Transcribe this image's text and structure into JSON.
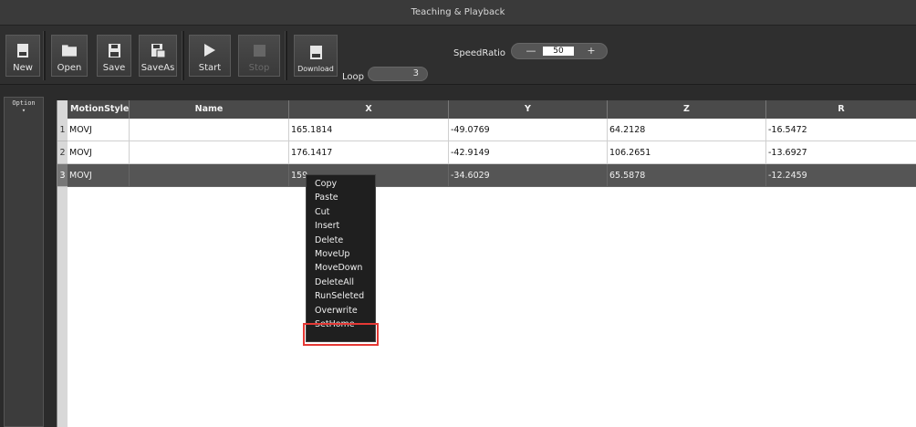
{
  "window": {
    "title": "Teaching & Playback"
  },
  "toolbar": {
    "new_label": "New",
    "open_label": "Open",
    "save_label": "Save",
    "saveas_label": "SaveAs",
    "start_label": "Start",
    "stop_label": "Stop",
    "download_label": "Download",
    "loop_label": "Loop",
    "loop_value": "3",
    "speed_label": "SpeedRatio",
    "speed_minus": "—",
    "speed_value": "50",
    "speed_plus": "+"
  },
  "sidebar": {
    "option_label": "Option"
  },
  "table": {
    "columns": [
      "MotionStyle",
      "Name",
      "X",
      "Y",
      "Z",
      "R"
    ],
    "rows": [
      {
        "num": "1",
        "motion": "MOVJ",
        "name": "",
        "x": "165.1814",
        "y": "-49.0769",
        "z": "64.2128",
        "r": "-16.5472"
      },
      {
        "num": "2",
        "motion": "MOVJ",
        "name": "",
        "x": "176.1417",
        "y": "-42.9149",
        "z": "106.2651",
        "r": "-13.6927"
      },
      {
        "num": "3",
        "motion": "MOVJ",
        "name": "",
        "x": "159.",
        "y": "-34.6029",
        "z": "65.5878",
        "r": "-12.2459"
      }
    ],
    "selected_row": 3
  },
  "context_menu": {
    "items": [
      "Copy",
      "Paste",
      "Cut",
      "Insert",
      "Delete",
      "MoveUp",
      "MoveDown",
      "DeleteAll",
      "RunSeleted",
      "Overwrite",
      "SetHome"
    ],
    "highlighted": "SetHome"
  },
  "colors": {
    "highlight_border": "#e53935",
    "selected_row": "#555555",
    "header": "#4a4a4a"
  }
}
